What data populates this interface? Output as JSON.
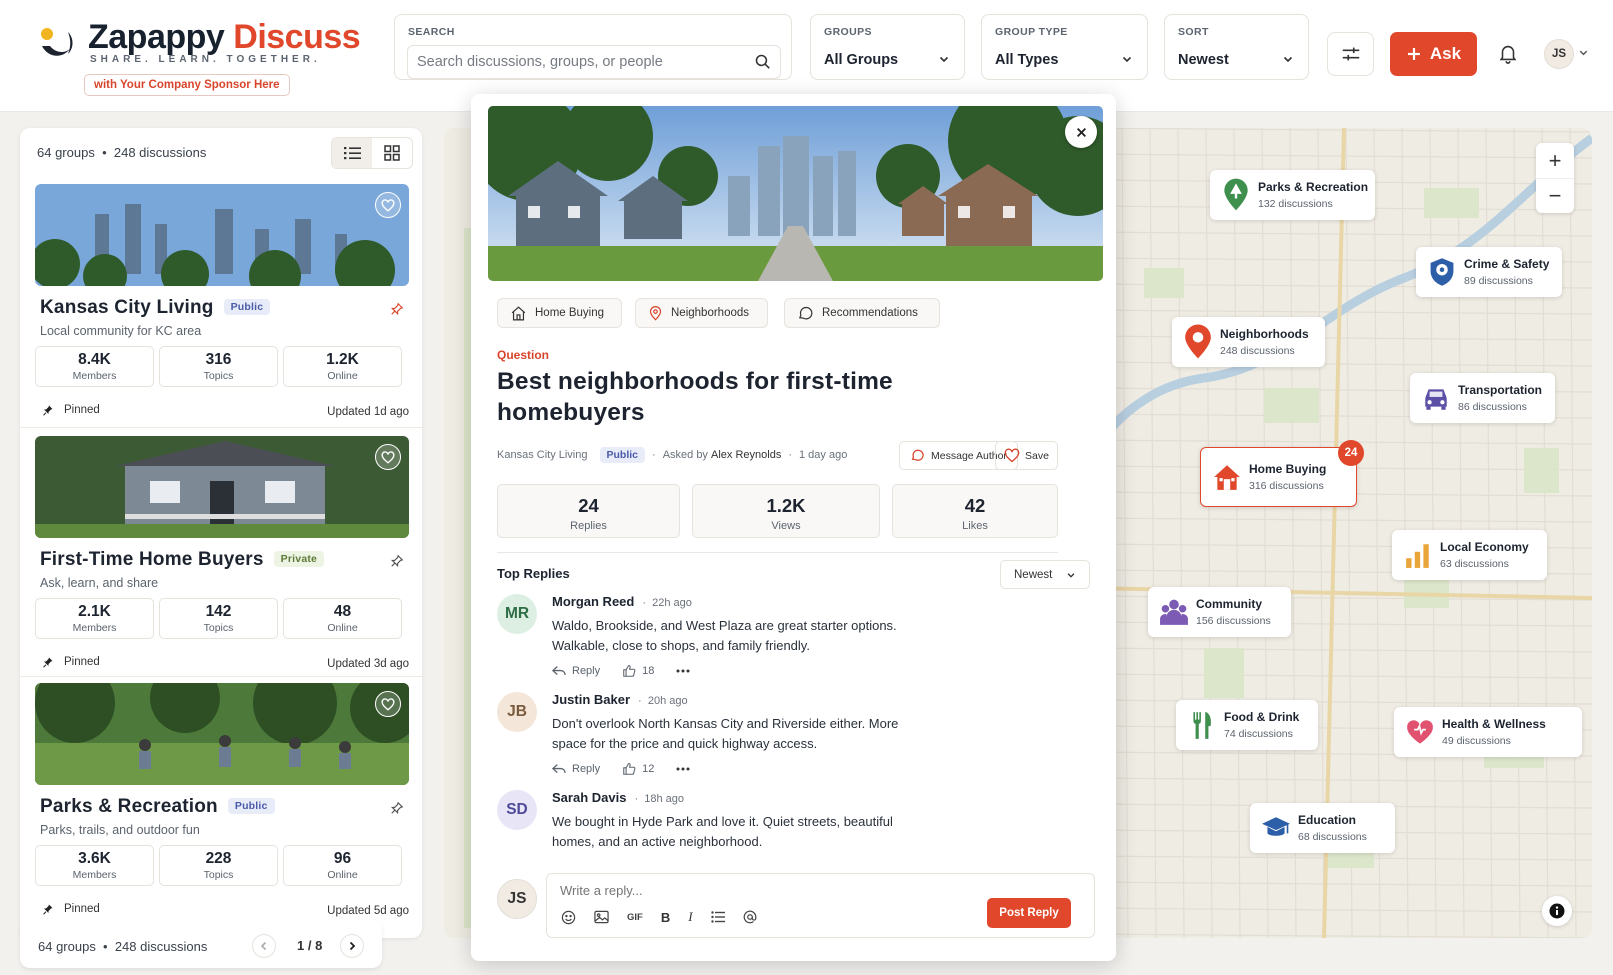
{
  "header": {
    "brand_part1": "Zapappy",
    "brand_part2": "Discuss",
    "tagline": "SHARE. LEARN. TOGETHER.",
    "sponsor": "with Your Company Sponsor Here",
    "search": {
      "label": "SEARCH",
      "placeholder": "Search discussions, groups, or people"
    },
    "groups": {
      "label": "GROUPS",
      "value": "All Groups"
    },
    "group_type": {
      "label": "GROUP TYPE",
      "value": "All Types"
    },
    "sort": {
      "label": "SORT",
      "value": "Newest"
    },
    "ask_label": "Ask",
    "user_initials": "JS"
  },
  "sidebar": {
    "summary_groups": "64 groups",
    "summary_sep": "•",
    "summary_discussions": "248 discussions",
    "cards": [
      {
        "title": "Kansas City Living",
        "badge": "Public",
        "desc": "Local community for KC area",
        "stats": [
          {
            "n": "8.4K",
            "l": "Members"
          },
          {
            "n": "316",
            "l": "Topics"
          },
          {
            "n": "1.2K",
            "l": "Online"
          }
        ],
        "pinned": "Pinned",
        "updated": "Updated 1d ago"
      },
      {
        "title": "First-Time Home Buyers",
        "badge": "Private",
        "desc": "Ask, learn, and share",
        "stats": [
          {
            "n": "2.1K",
            "l": "Members"
          },
          {
            "n": "142",
            "l": "Topics"
          },
          {
            "n": "48",
            "l": "Online"
          }
        ],
        "pinned": "Pinned",
        "updated": "Updated 3d ago"
      },
      {
        "title": "Parks & Recreation",
        "badge": "Public",
        "desc": "Parks, trails, and outdoor fun",
        "stats": [
          {
            "n": "3.6K",
            "l": "Members"
          },
          {
            "n": "228",
            "l": "Topics"
          },
          {
            "n": "96",
            "l": "Online"
          }
        ],
        "pinned": "Pinned",
        "updated": "Updated 5d ago"
      }
    ],
    "footer_groups": "64 groups",
    "footer_discussions": "248 discussions",
    "page": "1 / 8"
  },
  "detail": {
    "chips": [
      "Home Buying",
      "Neighborhoods",
      "Recommendations"
    ],
    "type": "Question",
    "title": "Best neighborhoods for first-time homebuyers",
    "group": "Kansas City Living",
    "badge": "Public",
    "asked_prefix": "Asked by",
    "author": "Alex Reynolds",
    "time": "1 day ago",
    "message_author": "Message Author",
    "save": "Save",
    "stats": [
      {
        "n": "24",
        "l": "Replies"
      },
      {
        "n": "1.2K",
        "l": "Views"
      },
      {
        "n": "42",
        "l": "Likes"
      }
    ],
    "replies_title": "Top Replies",
    "replies_sort": "Newest",
    "replies": [
      {
        "initials": "MR",
        "name": "Morgan Reed",
        "time": "22h ago",
        "text": "Waldo, Brookside, and West Plaza are great starter options. Walkable, close to shops, and family friendly.",
        "reply": "Reply",
        "likes": "18"
      },
      {
        "initials": "JB",
        "name": "Justin Baker",
        "time": "20h ago",
        "text": "Don't overlook North Kansas City and Riverside either. More space for the price and quick highway access.",
        "reply": "Reply",
        "likes": "12"
      },
      {
        "initials": "SD",
        "name": "Sarah Davis",
        "time": "18h ago",
        "text": "We bought in Hyde Park and love it. Quiet streets, beautiful homes, and an active neighborhood."
      }
    ],
    "composer_initials": "JS",
    "composer_placeholder": "Write a reply...",
    "gif_label": "GIF",
    "post_label": "Post Reply"
  },
  "map": {
    "categories": [
      {
        "title": "Parks & Recreation",
        "count": "132 discussions",
        "icon": "tree-pin-icon",
        "color": "#3f8f4e"
      },
      {
        "title": "Crime & Safety",
        "count": "89 discussions",
        "icon": "shield-icon",
        "color": "#2d5fa8"
      },
      {
        "title": "Neighborhoods",
        "count": "248 discussions",
        "icon": "map-pin-icon",
        "color": "#e0472b"
      },
      {
        "title": "Transportation",
        "count": "86 discussions",
        "icon": "car-icon",
        "color": "#5b4fa6"
      },
      {
        "title": "Home Buying",
        "count": "316 discussions",
        "icon": "house-icon",
        "color": "#e0472b",
        "badge": "24"
      },
      {
        "title": "Local Economy",
        "count": "63 discussions",
        "icon": "bar-chart-icon",
        "color": "#e9a53a"
      },
      {
        "title": "Community",
        "count": "156 discussions",
        "icon": "people-icon",
        "color": "#7c5bb4"
      },
      {
        "title": "Food & Drink",
        "count": "74 discussions",
        "icon": "fork-knife-icon",
        "color": "#3f8f4e"
      },
      {
        "title": "Health & Wellness",
        "count": "49 discussions",
        "icon": "heart-icon",
        "color": "#e05270"
      },
      {
        "title": "Education",
        "count": "68 discussions",
        "icon": "graduation-cap-icon",
        "color": "#2d5fa8"
      }
    ],
    "zoom_in": "+",
    "zoom_out": "−"
  }
}
